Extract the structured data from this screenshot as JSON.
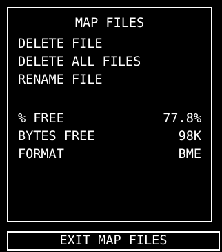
{
  "menu": {
    "title": "MAP FILES",
    "items": [
      {
        "label": "DELETE FILE"
      },
      {
        "label": "DELETE ALL FILES"
      },
      {
        "label": "RENAME FILE"
      }
    ]
  },
  "info": {
    "percent_free": {
      "label": "% FREE",
      "value": "77.8%"
    },
    "bytes_free": {
      "label": "BYTES FREE",
      "value": "98K"
    },
    "format": {
      "label": "FORMAT",
      "value": "BME"
    }
  },
  "footer": {
    "exit_label": "EXIT MAP FILES"
  },
  "colors": {
    "background": "#000000",
    "foreground": "#ffffff",
    "page": "#ffffff"
  }
}
